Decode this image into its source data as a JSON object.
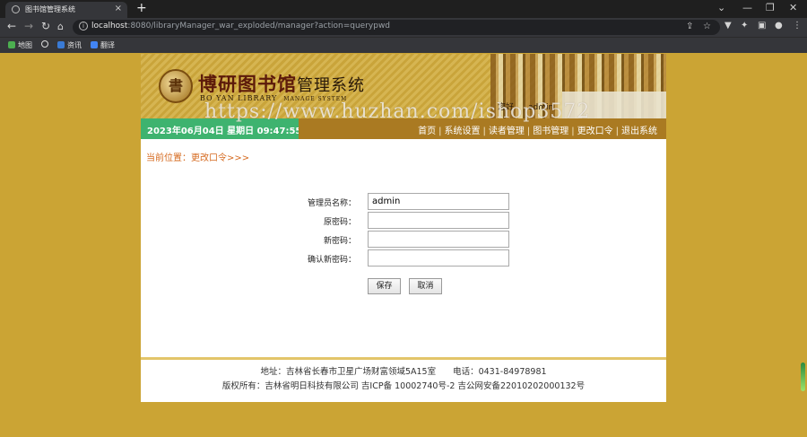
{
  "browser": {
    "tab_title": "图书馆管理系统",
    "url_host": "localhost",
    "url_rest": ":8080/libraryManager_war_exploded/manager?action=querypwd",
    "bookmarks": [
      "地图",
      "",
      "资讯",
      "翻译"
    ]
  },
  "header": {
    "logo_cn_bold": "博研图书馆",
    "logo_cn_light": "管理系统",
    "logo_en": "BO YAN LIBRARY",
    "logo_en_sub": "MANAGE SYSTEM",
    "greeting": "您好",
    "username": "admin",
    "datetime": "2023年06月04日 星期日 09:47:55",
    "menu": [
      "首页",
      "系统设置",
      "读者管理",
      "图书管理",
      "更改口令",
      "退出系统"
    ]
  },
  "breadcrumb": "当前位置：更改口令>>>",
  "form": {
    "fields": [
      {
        "label": "管理员名称：",
        "value": "admin"
      },
      {
        "label": "原密码：",
        "value": ""
      },
      {
        "label": "新密码：",
        "value": ""
      },
      {
        "label": "确认新密码：",
        "value": ""
      }
    ],
    "save_label": "保存",
    "cancel_label": "取消"
  },
  "footer": {
    "address_line": "地址：吉林省长春市卫星广场财富领域5A15室　　电话：0431-84978981",
    "copyright_line": "版权所有：吉林省明日科技有限公司 吉ICP备 10002740号-2 吉公网安备22010202000132号"
  },
  "watermark": "https://www.huzhan.com/ishop3572"
}
